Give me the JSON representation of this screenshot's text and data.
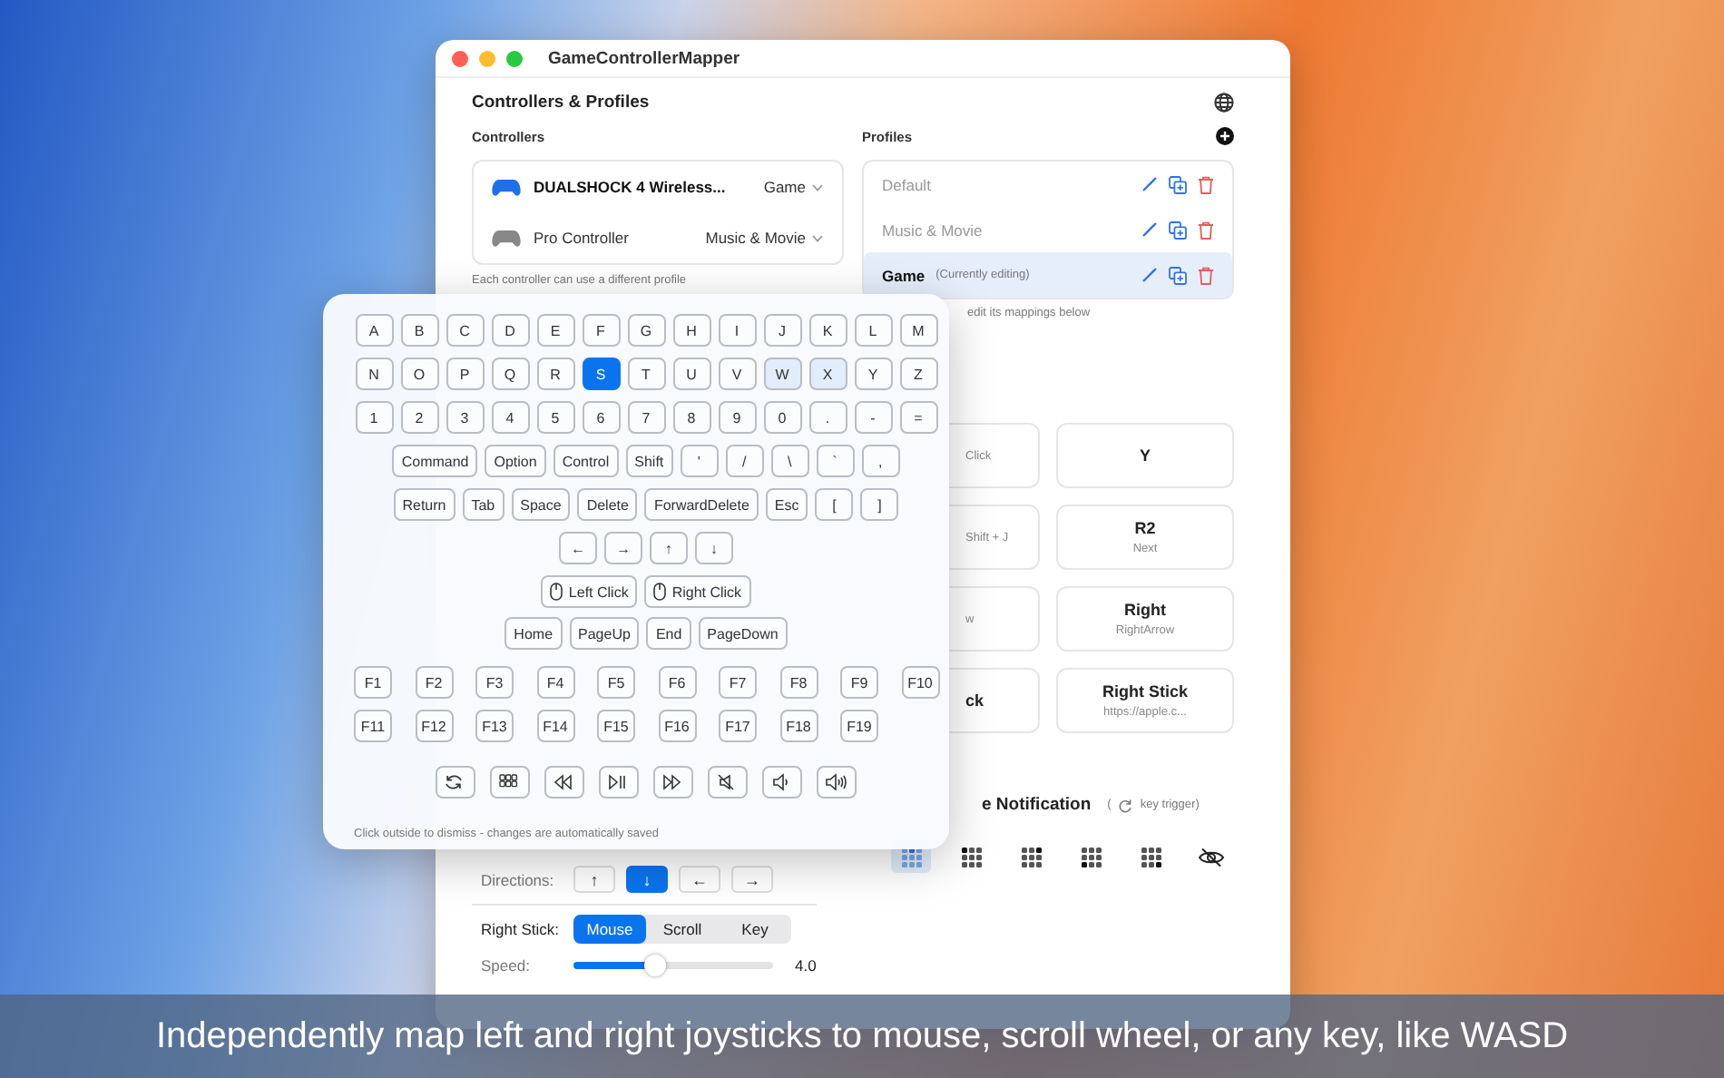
{
  "window": {
    "title": "GameControllerMapper"
  },
  "section_title": "Controllers & Profiles",
  "controllers": {
    "label": "Controllers",
    "items": [
      {
        "name": "DUALSHOCK 4 Wireless...",
        "profile": "Game",
        "active": true
      },
      {
        "name": "Pro Controller",
        "profile": "Music & Movie",
        "active": false
      }
    ],
    "note": "Each controller can use a different profile"
  },
  "profiles": {
    "label": "Profiles",
    "items": [
      {
        "name": "Default",
        "selected": false
      },
      {
        "name": "Music & Movie",
        "selected": false
      },
      {
        "name": "Game",
        "note": "(Currently editing)",
        "selected": true
      }
    ]
  },
  "profile_hint": "edit its mappings below",
  "mappings": [
    {
      "subtitle": "Click"
    },
    {
      "title": "Y"
    },
    {
      "subtitle": "Shift + J"
    },
    {
      "title": "R2",
      "subtitle": "Next"
    },
    {
      "subtitle": "w"
    },
    {
      "title": "Right",
      "subtitle": "RightArrow"
    },
    {
      "title": "ck"
    },
    {
      "title": "Right Stick",
      "subtitle": "https://apple.c..."
    }
  ],
  "notification": {
    "title": "e Notification",
    "hint_open": "(",
    "hint": "key trigger)",
    "positions": [
      {
        "selected": true
      },
      {
        "selected": false
      },
      {
        "selected": false
      },
      {
        "selected": false
      },
      {
        "selected": false
      },
      {
        "selected": false
      }
    ]
  },
  "directions": {
    "label": "Directions:",
    "items": [
      {
        "label": "↑",
        "selected": false
      },
      {
        "label": "↓",
        "selected": true
      },
      {
        "label": "←",
        "selected": false
      },
      {
        "label": "→",
        "selected": false
      }
    ]
  },
  "right_stick": {
    "label": "Right Stick:",
    "modes": [
      {
        "label": "Mouse",
        "selected": true
      },
      {
        "label": "Scroll",
        "selected": false
      },
      {
        "label": "Key",
        "selected": false
      }
    ]
  },
  "speed": {
    "label": "Speed:",
    "level": 0.41,
    "reading": "4.0"
  },
  "keyboard": {
    "rows": [
      {
        "kind": "keys",
        "keys": [
          {
            "label": "A",
            "selected": false,
            "mapped": false
          },
          {
            "label": "B",
            "selected": false,
            "mapped": false
          },
          {
            "label": "C",
            "selected": false,
            "mapped": false
          },
          {
            "label": "D",
            "selected": false,
            "mapped": false
          },
          {
            "label": "E",
            "selected": false,
            "mapped": false
          },
          {
            "label": "F",
            "selected": false,
            "mapped": false
          },
          {
            "label": "G",
            "selected": false,
            "mapped": false
          },
          {
            "label": "H",
            "selected": false,
            "mapped": false
          },
          {
            "label": "I",
            "selected": false,
            "mapped": false
          },
          {
            "label": "J",
            "selected": false,
            "mapped": false
          },
          {
            "label": "K",
            "selected": false,
            "mapped": false
          },
          {
            "label": "L",
            "selected": false,
            "mapped": false
          },
          {
            "label": "M",
            "selected": false,
            "mapped": false
          }
        ]
      },
      {
        "kind": "keys",
        "keys": [
          {
            "label": "N",
            "selected": false,
            "mapped": false
          },
          {
            "label": "O",
            "selected": false,
            "mapped": false
          },
          {
            "label": "P",
            "selected": false,
            "mapped": false
          },
          {
            "label": "Q",
            "selected": false,
            "mapped": false
          },
          {
            "label": "R",
            "selected": false,
            "mapped": false
          },
          {
            "label": "S",
            "selected": true,
            "mapped": false
          },
          {
            "label": "T",
            "selected": false,
            "mapped": false
          },
          {
            "label": "U",
            "selected": false,
            "mapped": false
          },
          {
            "label": "V",
            "selected": false,
            "mapped": false
          },
          {
            "label": "W",
            "selected": false,
            "mapped": true
          },
          {
            "label": "X",
            "selected": false,
            "mapped": true
          },
          {
            "label": "Y",
            "selected": false,
            "mapped": false
          },
          {
            "label": "Z",
            "selected": false,
            "mapped": false
          }
        ]
      },
      {
        "kind": "keys",
        "keys": [
          {
            "label": "1",
            "selected": false,
            "mapped": false
          },
          {
            "label": "2",
            "selected": false,
            "mapped": false
          },
          {
            "label": "3",
            "selected": false,
            "mapped": false
          },
          {
            "label": "4",
            "selected": false,
            "mapped": false
          },
          {
            "label": "5",
            "selected": false,
            "mapped": false
          },
          {
            "label": "6",
            "selected": false,
            "mapped": false
          },
          {
            "label": "7",
            "selected": false,
            "mapped": false
          },
          {
            "label": "8",
            "selected": false,
            "mapped": false
          },
          {
            "label": "9",
            "selected": false,
            "mapped": false
          },
          {
            "label": "0",
            "selected": false,
            "mapped": false
          },
          {
            "label": ".",
            "selected": false,
            "mapped": false
          },
          {
            "label": "-",
            "selected": false,
            "mapped": false
          },
          {
            "label": "=",
            "selected": false,
            "mapped": false
          }
        ]
      },
      {
        "kind": "keys",
        "keys": [
          {
            "label": "Command",
            "selected": false,
            "mapped": false
          },
          {
            "label": "Option",
            "selected": false,
            "mapped": false
          },
          {
            "label": "Control",
            "selected": false,
            "mapped": false
          },
          {
            "label": "Shift",
            "selected": false,
            "mapped": false
          },
          {
            "label": "'",
            "selected": false,
            "mapped": false
          },
          {
            "label": "/",
            "selected": false,
            "mapped": false
          },
          {
            "label": "\\",
            "selected": false,
            "mapped": false
          },
          {
            "label": "`",
            "selected": false,
            "mapped": false
          },
          {
            "label": ",",
            "selected": false,
            "mapped": false
          }
        ]
      },
      {
        "kind": "keys",
        "keys": [
          {
            "label": "Return",
            "selected": false,
            "mapped": false
          },
          {
            "label": "Tab",
            "selected": false,
            "mapped": false
          },
          {
            "label": "Space",
            "selected": false,
            "mapped": false
          },
          {
            "label": "Delete",
            "selected": false,
            "mapped": false
          },
          {
            "label": "ForwardDelete",
            "selected": false,
            "mapped": false
          },
          {
            "label": "Esc",
            "selected": false,
            "mapped": false
          },
          {
            "label": "[",
            "selected": false,
            "mapped": false
          },
          {
            "label": "]",
            "selected": false,
            "mapped": false
          }
        ]
      },
      {
        "kind": "keys",
        "keys": [
          {
            "label": "←",
            "selected": false,
            "mapped": false
          },
          {
            "label": "→",
            "selected": false,
            "mapped": false
          },
          {
            "label": "↑",
            "selected": false,
            "mapped": false
          },
          {
            "label": "↓",
            "selected": false,
            "mapped": false
          }
        ]
      },
      {
        "kind": "mouse",
        "keys": [
          {
            "label": "Left Click",
            "selected": false,
            "mapped": false
          },
          {
            "label": "Right Click",
            "selected": false,
            "mapped": false
          }
        ]
      },
      {
        "kind": "keys",
        "keys": [
          {
            "label": "Home",
            "selected": false,
            "mapped": false
          },
          {
            "label": "PageUp",
            "selected": false,
            "mapped": false
          },
          {
            "label": "End",
            "selected": false,
            "mapped": false
          },
          {
            "label": "PageDown",
            "selected": false,
            "mapped": false
          }
        ]
      },
      {
        "kind": "fkeys",
        "keys": [
          {
            "label": "F1",
            "selected": false,
            "mapped": false
          },
          {
            "label": "F2",
            "selected": false,
            "mapped": false
          },
          {
            "label": "F3",
            "selected": false,
            "mapped": false
          },
          {
            "label": "F4",
            "selected": false,
            "mapped": false
          },
          {
            "label": "F5",
            "selected": false,
            "mapped": false
          },
          {
            "label": "F6",
            "selected": false,
            "mapped": false
          },
          {
            "label": "F7",
            "selected": false,
            "mapped": false
          },
          {
            "label": "F8",
            "selected": false,
            "mapped": false
          },
          {
            "label": "F9",
            "selected": false,
            "mapped": false
          },
          {
            "label": "F10",
            "selected": false,
            "mapped": false
          },
          {
            "label": "F11",
            "selected": false,
            "mapped": false
          },
          {
            "label": "F12",
            "selected": false,
            "mapped": false
          },
          {
            "label": "F13",
            "selected": false,
            "mapped": false
          },
          {
            "label": "F14",
            "selected": false,
            "mapped": false
          },
          {
            "label": "F15",
            "selected": false,
            "mapped": false
          },
          {
            "label": "F16",
            "selected": false,
            "mapped": false
          },
          {
            "label": "F17",
            "selected": false,
            "mapped": false
          },
          {
            "label": "F18",
            "selected": false,
            "mapped": false
          },
          {
            "label": "F19",
            "selected": false,
            "mapped": false
          }
        ]
      },
      {
        "kind": "media",
        "keys": [
          {
            "selected": false,
            "mapped": false
          },
          {
            "selected": false,
            "mapped": false
          },
          {
            "selected": false,
            "mapped": false
          },
          {
            "selected": false,
            "mapped": false
          },
          {
            "selected": false,
            "mapped": false
          },
          {
            "selected": false,
            "mapped": false
          },
          {
            "selected": false,
            "mapped": false
          },
          {
            "selected": false,
            "mapped": false
          }
        ]
      }
    ],
    "footer": "Click outside to dismiss - changes are automatically saved"
  },
  "caption": "Independently map left and right joysticks to mouse, scroll wheel, or any key, like WASD"
}
